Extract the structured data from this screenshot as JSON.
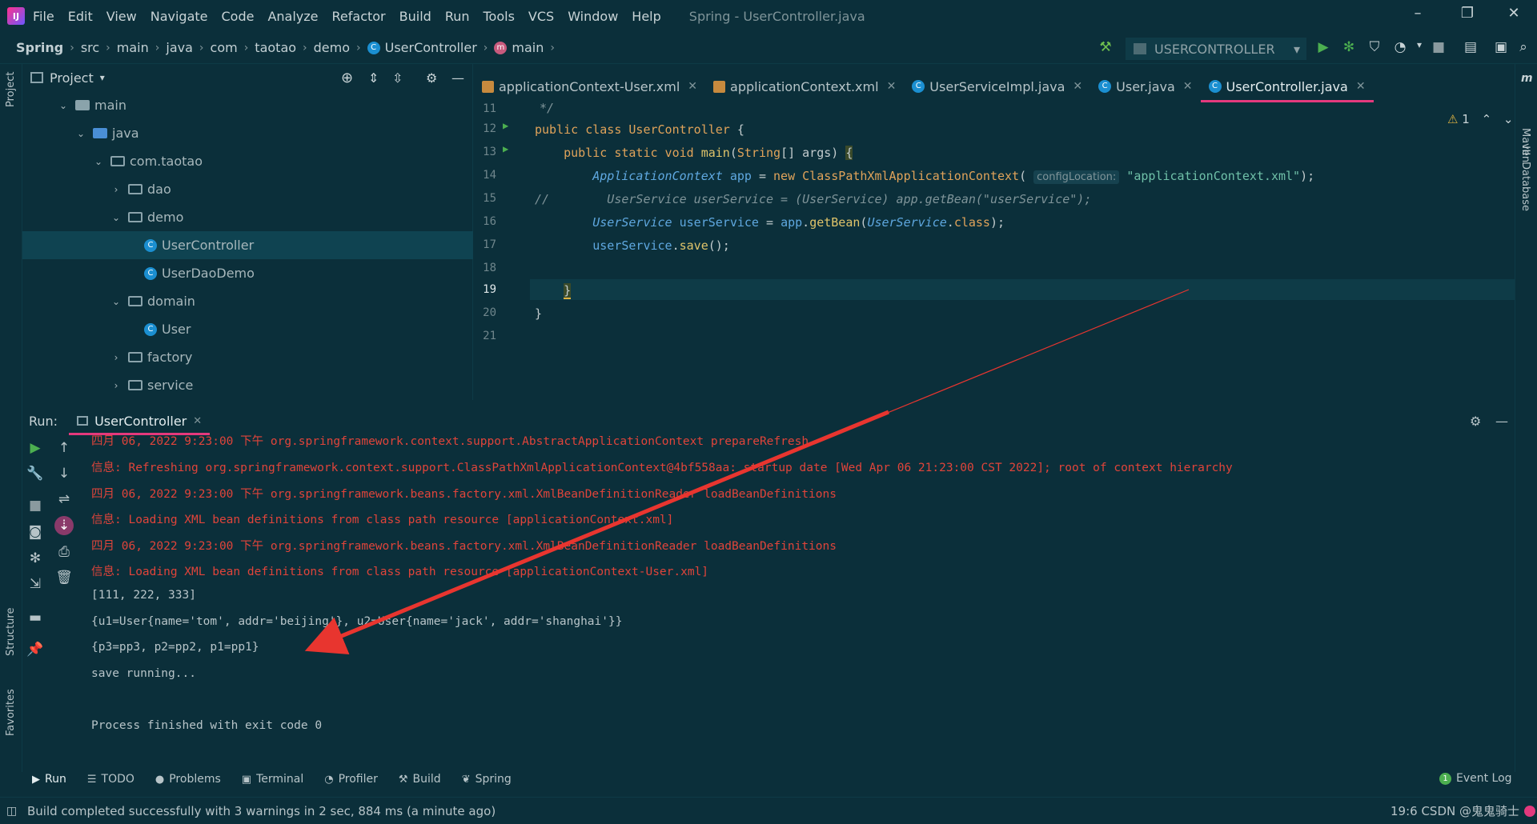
{
  "menubar": {
    "items": [
      "File",
      "Edit",
      "View",
      "Navigate",
      "Code",
      "Analyze",
      "Refactor",
      "Build",
      "Run",
      "Tools",
      "VCS",
      "Window",
      "Help"
    ],
    "window_title": "Spring - UserController.java"
  },
  "navbar": {
    "breadcrumbs": [
      "Spring",
      "src",
      "main",
      "java",
      "com",
      "taotao",
      "demo",
      "UserController",
      "main"
    ],
    "run_config": "USERCONTROLLER"
  },
  "project_panel": {
    "title": "Project",
    "tree": [
      {
        "label": "main",
        "arrow": "⌄"
      },
      {
        "label": "java",
        "arrow": "⌄"
      },
      {
        "label": "com.taotao",
        "arrow": "⌄"
      },
      {
        "label": "dao",
        "arrow": "›"
      },
      {
        "label": "demo",
        "arrow": "⌄"
      },
      {
        "label": "UserController",
        "arrow": ""
      },
      {
        "label": "UserDaoDemo",
        "arrow": ""
      },
      {
        "label": "domain",
        "arrow": "⌄"
      },
      {
        "label": "User",
        "arrow": ""
      },
      {
        "label": "factory",
        "arrow": "›"
      },
      {
        "label": "service",
        "arrow": "›"
      }
    ]
  },
  "editor_tabs": [
    {
      "label": "applicationContext-User.xml"
    },
    {
      "label": "applicationContext.xml"
    },
    {
      "label": "UserServiceImpl.java"
    },
    {
      "label": "User.java"
    },
    {
      "label": "UserController.java"
    }
  ],
  "editor": {
    "line_numbers": [
      "11",
      "12",
      "13",
      "14",
      "15",
      "16",
      "17",
      "18",
      "19",
      "20",
      "21"
    ],
    "warning_count": "1",
    "param_hint": "configLocation:",
    "code": {
      "l11": "*/",
      "l15": "//        UserService userService = (UserService) app.getBean(\"userService\");"
    }
  },
  "run_panel": {
    "label": "Run:",
    "tab": "UserController",
    "console": [
      "四月 06, 2022 9:23:00 下午 org.springframework.context.support.AbstractApplicationContext prepareRefresh",
      "信息: Refreshing org.springframework.context.support.ClassPathXmlApplicationContext@4bf558aa: startup date [Wed Apr 06 21:23:00 CST 2022]; root of context hierarchy",
      "四月 06, 2022 9:23:00 下午 org.springframework.beans.factory.xml.XmlBeanDefinitionReader loadBeanDefinitions",
      "信息: Loading XML bean definitions from class path resource [applicationContext.xml]",
      "四月 06, 2022 9:23:00 下午 org.springframework.beans.factory.xml.XmlBeanDefinitionReader loadBeanDefinitions",
      "信息: Loading XML bean definitions from class path resource [applicationContext-User.xml]",
      "[111, 222, 333]",
      "{u1=User{name='tom', addr='beijing'}, u2=User{name='jack', addr='shanghai'}}",
      "{p3=pp3, p2=pp2, p1=pp1}",
      "save running...",
      "",
      "Process finished with exit code 0"
    ]
  },
  "bottom_tabs": [
    "Run",
    "TODO",
    "Problems",
    "Terminal",
    "Profiler",
    "Build",
    "Spring"
  ],
  "event_log": "Event Log",
  "event_log_count": "1",
  "status": {
    "text": "Build completed successfully with 3 warnings in 2 sec, 884 ms (a minute ago)",
    "right": "19:6   CSDN @鬼鬼骑士"
  },
  "side_labels": {
    "project": "Project",
    "structure": "Structure",
    "favorites": "Favorites",
    "maven": "Maven",
    "database": "Database"
  },
  "colors": {
    "background": "#0b2f3a",
    "accent": "#e4397d",
    "error_text": "#e0443a",
    "run_green": "#4caf50",
    "arrow": "#e8352f"
  }
}
